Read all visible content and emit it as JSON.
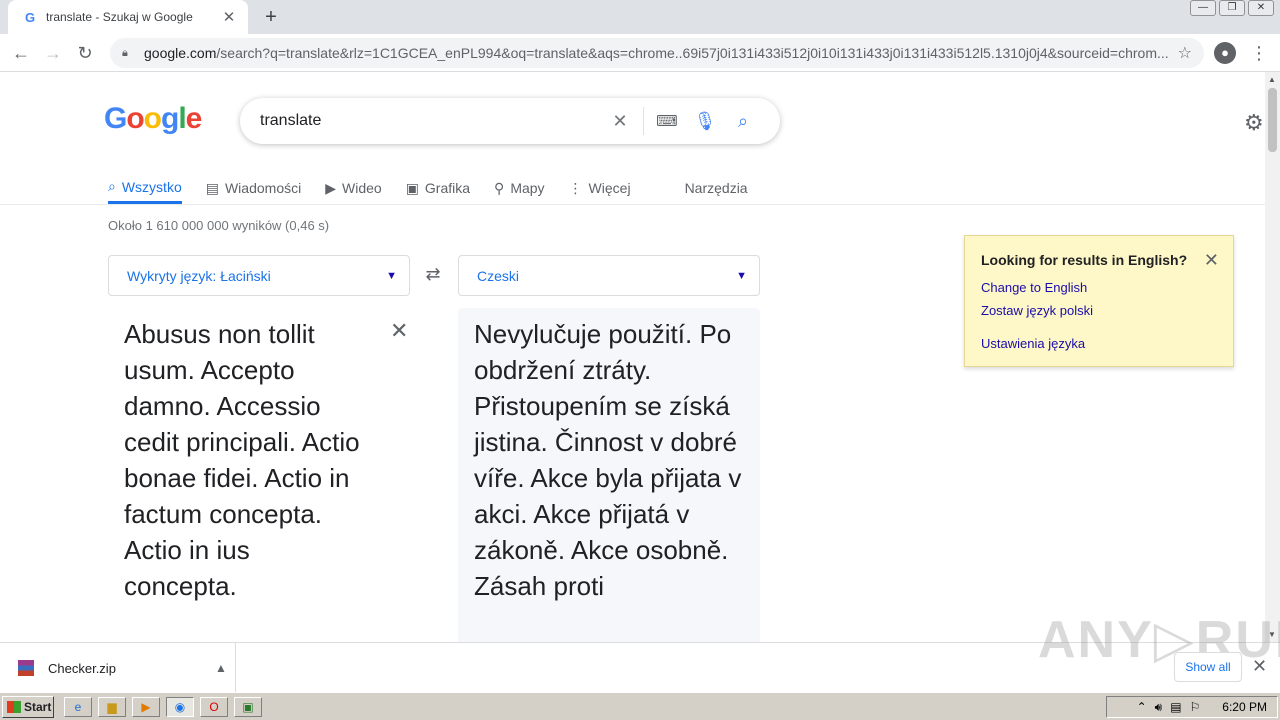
{
  "browser": {
    "tab_title": "translate - Szukaj w Google",
    "tab_favicon": "G",
    "url_host": "google.com",
    "url_rest": "/search?q=translate&rlz=1C1GCEA_enPL994&oq=translate&aqs=chrome..69i57j0i131i433i512j0i10i131i433j0i131i433i512l5.1310j0j4&sourceid=chrom..."
  },
  "search": {
    "logo": [
      "G",
      "o",
      "o",
      "g",
      "l",
      "e"
    ],
    "logo_colors": [
      "#4285f4",
      "#ea4335",
      "#fbbc05",
      "#4285f4",
      "#34a853",
      "#ea4335"
    ],
    "query": "translate"
  },
  "tabs": {
    "all": "Wszystko",
    "news": "Wiadomości",
    "video": "Wideo",
    "images": "Grafika",
    "maps": "Mapy",
    "more": "Więcej",
    "tools": "Narzędzia"
  },
  "stats": "Około 1 610 000 000 wyników (0,46 s)",
  "translator": {
    "source_lang": "Wykryty język: Łaciński",
    "target_lang": "Czeski",
    "source_text": "Abusus non tollit usum. Accepto damno. Accessio cedit principali. Actio bonae fidei. Actio in factum concepta. Actio in ius concepta.",
    "target_text": "Nevylučuje použití. Po obdržení ztráty. Přistoupením se získá jistina. Činnost v dobré víře. Akce byla přijata v akci. Akce přijatá v zákoně. Akce osobně. Zásah proti"
  },
  "popup": {
    "heading": "Looking for results in English?",
    "change": "Change to English",
    "keep": "Zostaw język polski",
    "settings": "Ustawienia języka"
  },
  "downloads": {
    "file": "Checker.zip",
    "show_all": "Show all"
  },
  "watermark": "ANY▷RUN",
  "taskbar": {
    "start": "Start",
    "clock": "6:20 PM"
  }
}
